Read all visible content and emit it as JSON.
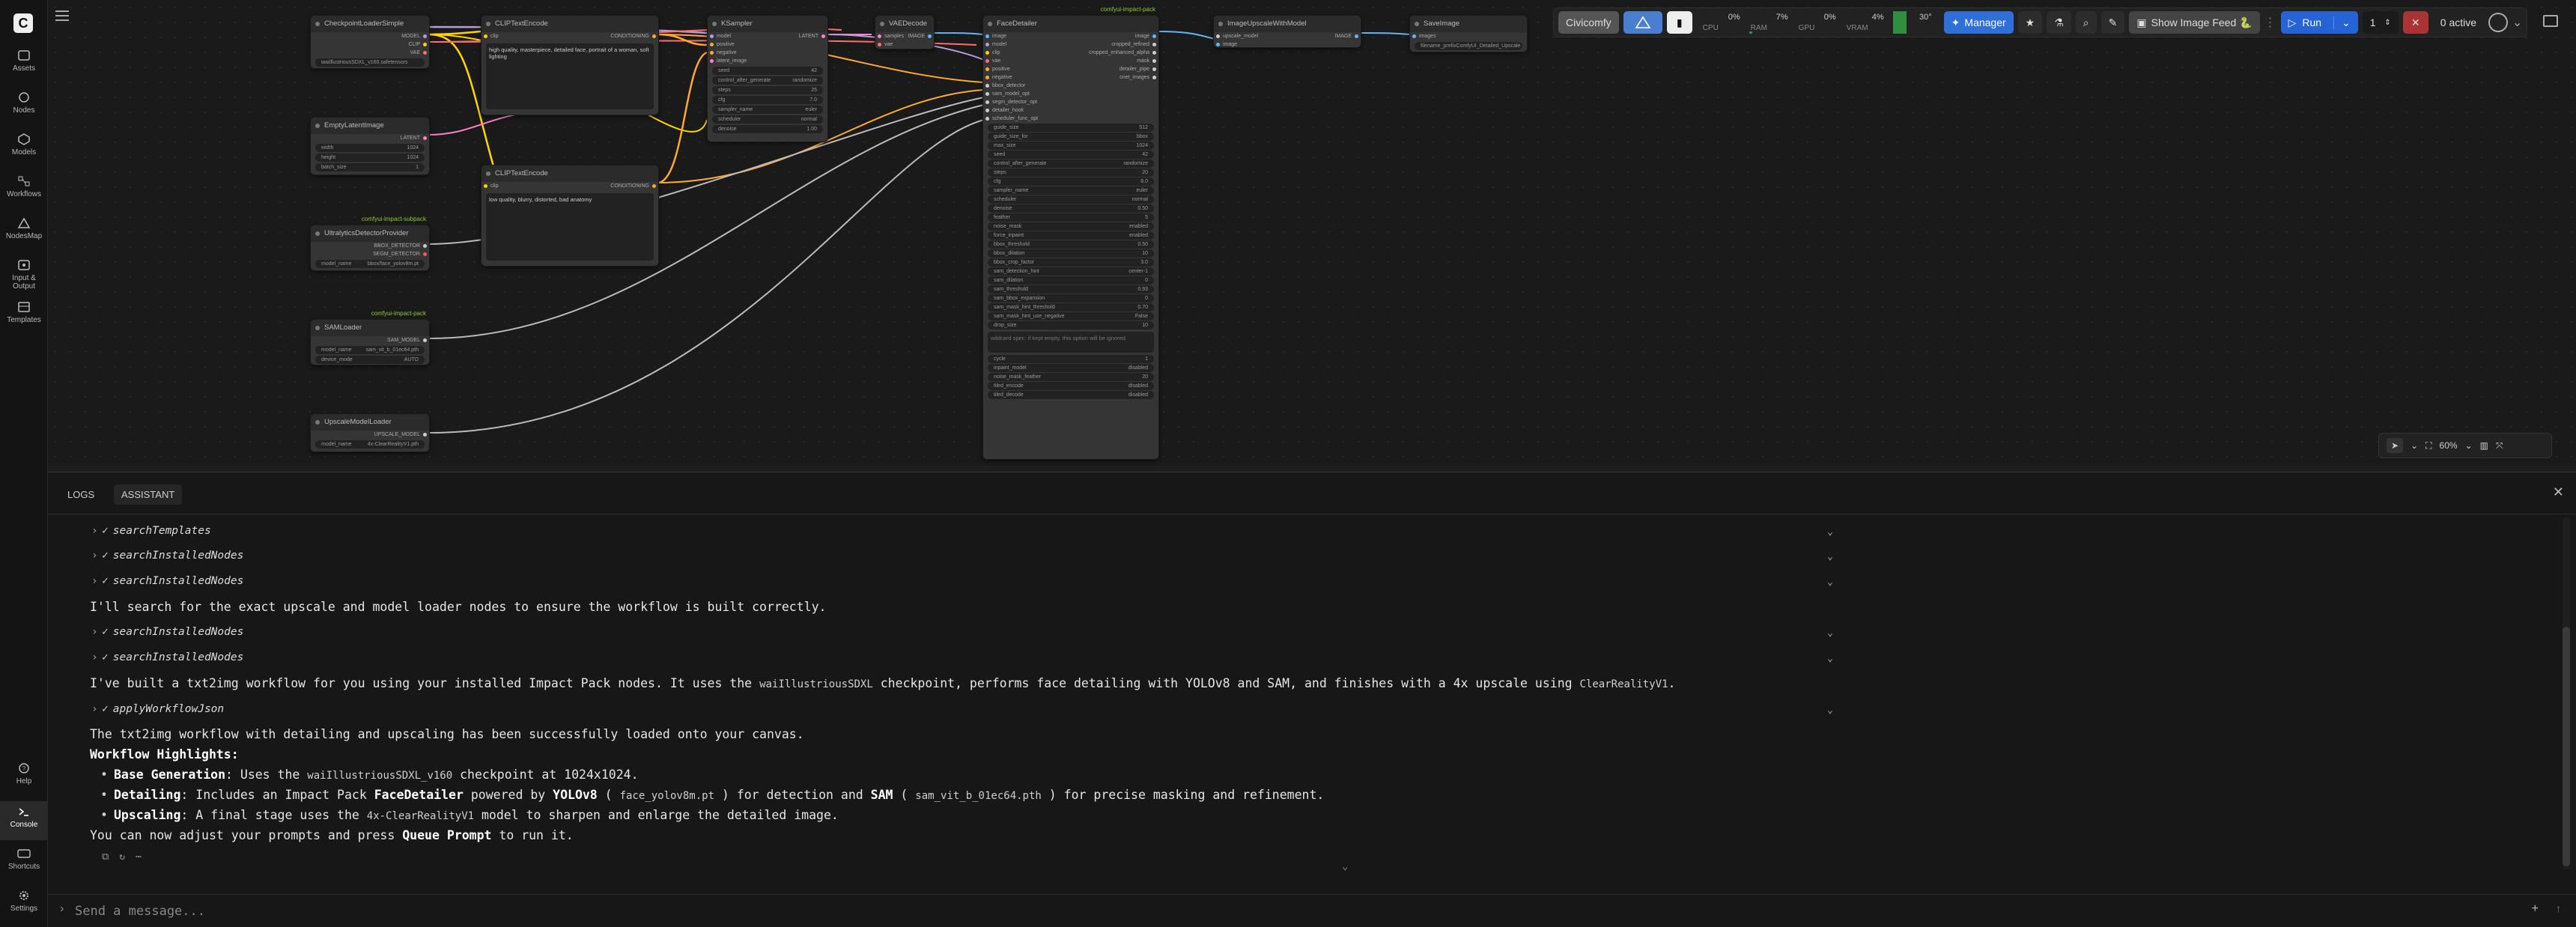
{
  "rail": {
    "items": [
      {
        "label": "Assets",
        "icon": "assets-icon"
      },
      {
        "label": "Nodes",
        "icon": "nodes-icon"
      },
      {
        "label": "Models",
        "icon": "models-icon"
      },
      {
        "label": "Workflows",
        "icon": "workflows-icon"
      },
      {
        "label": "NodesMap",
        "icon": "nodesmap-icon"
      },
      {
        "label": "Input & Output",
        "icon": "input-output-icon"
      },
      {
        "label": "Templates",
        "icon": "templates-icon"
      }
    ],
    "bottom_items": [
      {
        "label": "Help",
        "icon": "help-icon"
      },
      {
        "label": "Console",
        "icon": "console-icon"
      },
      {
        "label": "Shortcuts",
        "icon": "shortcuts-icon"
      },
      {
        "label": "Settings",
        "icon": "settings-icon"
      }
    ]
  },
  "topbar": {
    "civicomfy": "Civicomfy",
    "monitor": [
      {
        "label": "CPU",
        "value": "0%"
      },
      {
        "label": "RAM",
        "value": "7%"
      },
      {
        "label": "GPU",
        "value": "0%"
      },
      {
        "label": "VRAM",
        "value": "4%"
      },
      {
        "label": "Temp",
        "value": "30°"
      }
    ],
    "manager": "Manager",
    "show_feed": "Show Image Feed 🐍",
    "run": "Run",
    "batch": "1",
    "active": "0 active",
    "accent": "#2f6fd8"
  },
  "canvas": {
    "zoom": "60%",
    "nodes": {
      "checkpoint": {
        "title": "CheckpointLoaderSimple",
        "outputs": [
          "MODEL",
          "CLIP",
          "VAE"
        ],
        "widget": "waiIllustriousSDXL_v160.safetensors"
      },
      "empty_latent": {
        "title": "EmptyLatentImage",
        "output": "LATENT",
        "widgets": [
          [
            "width",
            "1024"
          ],
          [
            "height",
            "1024"
          ],
          [
            "batch_size",
            "1"
          ]
        ]
      },
      "ultra": {
        "title": "UltralyticsDetectorProvider",
        "pack": "comfyui-impact-subpack",
        "outputs": [
          "BBOX_DETECTOR",
          "SEGM_DETECTOR"
        ],
        "widget": [
          "model_name",
          "bbox/face_yolov8m.pt"
        ]
      },
      "sam": {
        "title": "SAMLoader",
        "pack": "comfyui-impact-pack",
        "output": "SAM_MODEL",
        "widgets": [
          [
            "model_name",
            "sam_vit_b_01ec64.pth"
          ],
          [
            "device_mode",
            "AUTO"
          ]
        ]
      },
      "upscale_loader": {
        "title": "UpscaleModelLoader",
        "output": "UPSCALE_MODEL",
        "widget": [
          "model_name",
          "4x-ClearRealityV1.pth"
        ]
      },
      "clip_pos": {
        "title": "CLIPTextEncode",
        "input": "clip",
        "output": "CONDITIONING",
        "text": "high quality, masterpiece, detailed face, portrait of a woman, soft lighting"
      },
      "clip_neg": {
        "title": "CLIPTextEncode",
        "input": "clip",
        "output": "CONDITIONING",
        "text": "low quality, blurry, distorted, bad anatomy"
      },
      "ksampler": {
        "title": "KSampler",
        "inputs": [
          "model",
          "positive",
          "negative",
          "latent_image"
        ],
        "output": "LATENT",
        "widgets": [
          [
            "seed",
            "42"
          ],
          [
            "control_after_generate",
            "randomize"
          ],
          [
            "steps",
            "25"
          ],
          [
            "cfg",
            "7.0"
          ],
          [
            "sampler_name",
            "euler"
          ],
          [
            "scheduler",
            "normal"
          ],
          [
            "denoise",
            "1.00"
          ]
        ]
      },
      "vae_decode": {
        "title": "VAEDecode",
        "inputs": [
          "samples",
          "vae"
        ],
        "output": "IMAGE"
      },
      "face_detailer": {
        "title": "FaceDetailer",
        "pack": "comfyui-impact-pack",
        "inputs": [
          "image",
          "model",
          "clip",
          "vae",
          "positive",
          "negative",
          "bbox_detector",
          "sam_model_opt",
          "segm_detector_opt",
          "detailer_hook",
          "scheduler_func_opt"
        ],
        "outputs": [
          "image",
          "cropped_refined",
          "cropped_enhanced_alpha",
          "mask",
          "detailer_pipe",
          "cnet_images"
        ],
        "widgets": [
          [
            "guide_size",
            "512"
          ],
          [
            "guide_size_for",
            "bbox"
          ],
          [
            "max_size",
            "1024"
          ],
          [
            "seed",
            "42"
          ],
          [
            "control_after_generate",
            "randomize"
          ],
          [
            "steps",
            "20"
          ],
          [
            "cfg",
            "8.0"
          ],
          [
            "sampler_name",
            "euler"
          ],
          [
            "scheduler",
            "normal"
          ],
          [
            "denoise",
            "0.50"
          ],
          [
            "feather",
            "5"
          ],
          [
            "noise_mask",
            "enabled"
          ],
          [
            "force_inpaint",
            "enabled"
          ],
          [
            "bbox_threshold",
            "0.50"
          ],
          [
            "bbox_dilation",
            "10"
          ],
          [
            "bbox_crop_factor",
            "3.0"
          ],
          [
            "sam_detection_hint",
            "center-1"
          ],
          [
            "sam_dilation",
            "0"
          ],
          [
            "sam_threshold",
            "0.93"
          ],
          [
            "sam_bbox_expansion",
            "0"
          ],
          [
            "sam_mask_hint_threshold",
            "0.70"
          ],
          [
            "sam_mask_hint_use_negative",
            "False"
          ],
          [
            "drop_size",
            "10"
          ]
        ],
        "wildcard": "wildcard spec: if kept empty, this option will be ignored",
        "widgets2": [
          [
            "cycle",
            "1"
          ],
          [
            "inpaint_model",
            "disabled"
          ],
          [
            "noise_mask_feather",
            "20"
          ],
          [
            "tiled_encode",
            "disabled"
          ],
          [
            "tiled_decode",
            "disabled"
          ]
        ]
      },
      "upscale_with": {
        "title": "ImageUpscaleWithModel",
        "inputs": [
          "upscale_model",
          "image"
        ],
        "output": "IMAGE"
      },
      "save": {
        "title": "SaveImage",
        "input": "images",
        "widget": [
          "filename_prefix",
          "ComfyUI_Detailed_Upscale"
        ]
      }
    }
  },
  "panel": {
    "tabs": [
      "LOGS",
      "ASSISTANT"
    ],
    "messages": {
      "t1": "searchTemplates",
      "t2": "searchInstalledNodes",
      "t3": "searchInstalledNodes",
      "m1": "I'll search for the exact upscale and model loader nodes to ensure the workflow is built correctly.",
      "t4": "searchInstalledNodes",
      "t5": "searchInstalledNodes",
      "m2a": "I've built a txt2img workflow for you using your installed Impact Pack nodes. It uses the",
      "m2b": "waiIllustriousSDXL",
      "m2c": "checkpoint, performs face detailing with YOLOv8 and SAM, and finishes with a 4x upscale using",
      "m2d": "ClearRealityV1",
      "m2e": ".",
      "t6": "applyWorkflowJson",
      "m3": "The txt2img workflow with detailing and upscaling has been successfully loaded onto your canvas.",
      "h": "Workflow Highlights:",
      "b1_label": "Base Generation",
      "b1a": ": Uses the",
      "b1_code": "waiIllustriousSDXL_v160",
      "b1b": "checkpoint at 1024x1024.",
      "b2_label": "Detailing",
      "b2a": ": Includes an Impact Pack",
      "b2_bold": "FaceDetailer",
      "b2b": "powered by",
      "b2_bold2": "YOLOv8",
      "b2_code": "face_yolov8m.pt",
      "b2c": "for detection and",
      "b2_bold3": "SAM",
      "b2_code2": "sam_vit_b_01ec64.pth",
      "b2d": "for precise masking and refinement.",
      "b3_label": "Upscaling",
      "b3a": ": A final stage uses the",
      "b3_code": "4x-ClearRealityV1",
      "b3b": "model to sharpen and enlarge the detailed image.",
      "m4a": "You can now adjust your prompts and press",
      "m4_bold": "Queue Prompt",
      "m4b": "to run it."
    },
    "composer_placeholder": "Send a message..."
  }
}
